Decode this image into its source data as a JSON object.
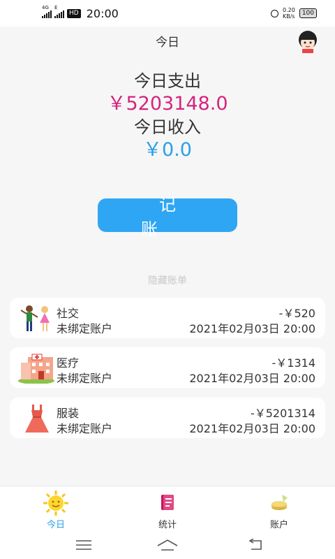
{
  "status_bar": {
    "network_1": "4G",
    "network_2": "E",
    "hd": "HD",
    "time": "20:00",
    "speed_value": "0.20",
    "speed_unit": "KB/s",
    "battery": "100"
  },
  "header": {
    "title": "今日"
  },
  "summary": {
    "expense_label": "今日支出",
    "expense_amount": "￥5203148.0",
    "income_label": "今日收入",
    "income_amount": "￥0.0"
  },
  "record_button": "记账",
  "hide_bills": "隐藏账单",
  "bills": [
    {
      "category": "社交",
      "account": "未绑定账户",
      "amount": "-￥520",
      "datetime": "2021年02月03日 20:00",
      "icon": "social-icon"
    },
    {
      "category": "医疗",
      "account": "未绑定账户",
      "amount": "-￥1314",
      "datetime": "2021年02月03日 20:00",
      "icon": "hospital-icon"
    },
    {
      "category": "服装",
      "account": "未绑定账户",
      "amount": "-￥5201314",
      "datetime": "2021年02月03日 20:00",
      "icon": "dress-icon"
    }
  ],
  "tabs": [
    {
      "label": "今日",
      "icon": "sun-icon",
      "active": true
    },
    {
      "label": "统计",
      "icon": "book-icon",
      "active": false
    },
    {
      "label": "账户",
      "icon": "money-icon",
      "active": false
    }
  ],
  "colors": {
    "accent": "#2ea6f3",
    "expense": "#d6237f",
    "income": "#2b9fe8"
  }
}
